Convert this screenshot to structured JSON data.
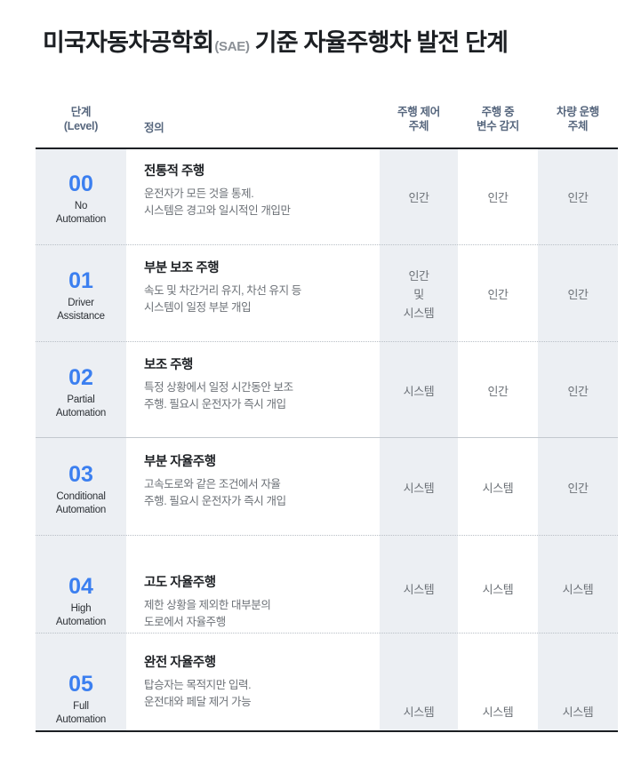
{
  "title": {
    "main": "미국자동차공학회",
    "sub": "(SAE)",
    "tail": "기준 자율주행차 발전 단계"
  },
  "colors": {
    "accent_blue": "#3b7ff0",
    "header_text": "#57677e",
    "band_shade": "#eceff3",
    "title_text": "#1c1f23",
    "body_text": "#6c7177",
    "rule_dark": "#1c1f23"
  },
  "header": {
    "level": "단계\n(Level)",
    "definition": "정의",
    "col1": "주행 제어\n주체",
    "col2": "주행 중\n변수 감지",
    "col3": "차량 운행\n주체"
  },
  "rows": [
    {
      "level_num": "00",
      "level_en": "No\nAutomation",
      "def_title": "전통적 주행",
      "def_body": "운전자가 모든 것을 통제.\n시스템은 경고와 일시적인 개입만",
      "col1": "인간",
      "col2": "인간",
      "col3": "인간"
    },
    {
      "level_num": "01",
      "level_en": "Driver\nAssistance",
      "def_title": "부분 보조 주행",
      "def_body": "속도 및 차간거리 유지, 차선 유지 등\n시스템이 일정 부분 개입",
      "col1": "인간\n및\n시스템",
      "col2": "인간",
      "col3": "인간"
    },
    {
      "level_num": "02",
      "level_en": "Partial\nAutomation",
      "def_title": "보조 주행",
      "def_body": "특정 상황에서 일정 시간동안 보조\n주행. 필요시 운전자가 즉시 개입",
      "col1": "시스템",
      "col2": "인간",
      "col3": "인간"
    },
    {
      "level_num": "03",
      "level_en": "Conditional\nAutomation",
      "def_title": "부분 자율주행",
      "def_body": "고속도로와 같은 조건에서 자율\n주행. 필요시 운전자가 즉시 개입",
      "col1": "시스템",
      "col2": "시스템",
      "col3": "인간"
    },
    {
      "level_num": "04",
      "level_en": "High\nAutomation",
      "def_title": "고도 자율주행",
      "def_body": "제한 상황을 제외한 대부분의\n도로에서 자율주행",
      "col1": "시스템",
      "col2": "시스템",
      "col3": "시스템"
    },
    {
      "level_num": "05",
      "level_en": "Full\nAutomation",
      "def_title": "완전 자율주행",
      "def_body": "탑승자는 목적지만 입력.\n운전대와 페달 제거 가능",
      "col1": "시스템",
      "col2": "시스템",
      "col3": "시스템"
    }
  ]
}
